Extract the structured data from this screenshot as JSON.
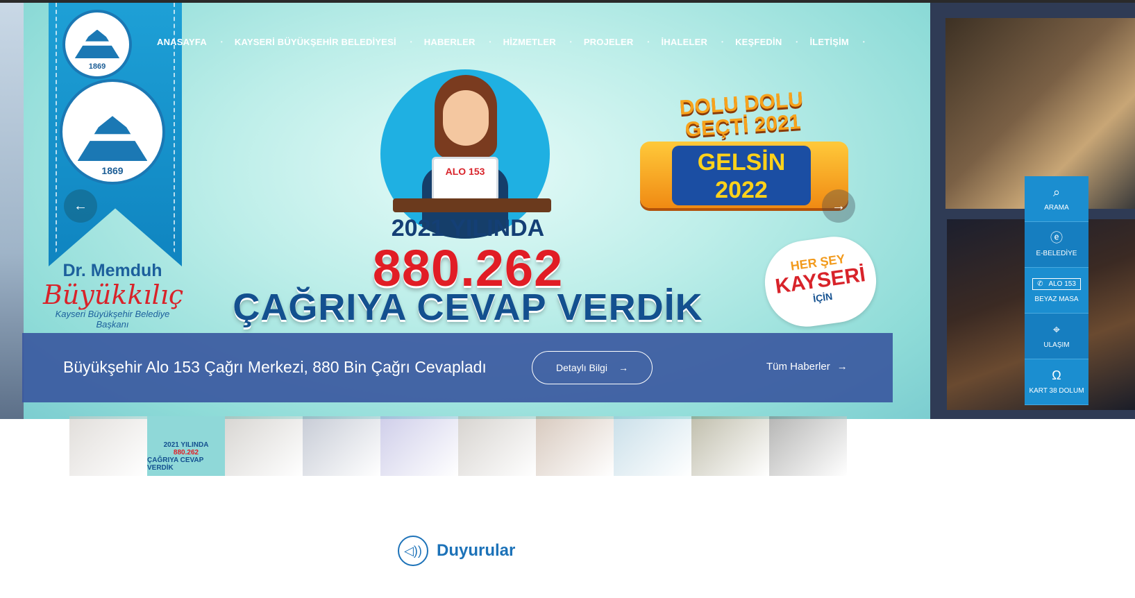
{
  "nav": {
    "items": [
      "ANASAYFA",
      "KAYSERİ BÜYÜKŞEHİR BELEDİYESİ",
      "HABERLER",
      "HİZMETLER",
      "PROJELER",
      "İHALELER",
      "KEŞFEDİN",
      "İLETİŞİM"
    ]
  },
  "logo": {
    "seal_small_year": "1869",
    "seal_large_year": "1869"
  },
  "mayor": {
    "title": "Dr. Memduh",
    "name": "Büyükkılıç",
    "role": "Kayseri Büyükşehir Belediye Başkanı"
  },
  "slide": {
    "year_line": "2021 YILINDA",
    "number": "880.262",
    "big_line": "ÇAĞRIYA CEVAP VERDİK",
    "laptop_text": "ALO 153",
    "badge_line1": "DOLU DOLU GEÇTİ 2021",
    "badge_line2": "GELSİN 2022",
    "sticker_top": "HER ŞEY",
    "sticker_mid": "KAYSERİ",
    "sticker_bottom": "İÇİN"
  },
  "caption": {
    "title": "Büyükşehir Alo 153 Çağrı Merkezi, 880 Bin Çağrı Cevapladı",
    "details_button": "Detaylı Bilgi",
    "all_news": "Tüm Haberler"
  },
  "side_menu": {
    "search": "ARAMA",
    "ebelediye": "E-BELEDİYE",
    "alo": "ALO 153",
    "beyaz_masa": "BEYAZ MASA",
    "ulasim": "ULAŞIM",
    "kart38": "KART 38 DOLUM"
  },
  "thumbnails": {
    "active_year": "2021 YILINDA",
    "active_number": "880.262",
    "active_text": "ÇAĞRIYA CEVAP VERDİK",
    "colors": [
      "#c9c3bd",
      "#8fd8d8",
      "#b8b4ae",
      "#9aa2b5",
      "#a8a6d8",
      "#b7b1aa",
      "#b89e8a",
      "#9fc6d8",
      "#8e8a6a",
      "#7a7a78",
      "#c8c2b8"
    ]
  },
  "announcements": {
    "title": "Duyurular"
  }
}
